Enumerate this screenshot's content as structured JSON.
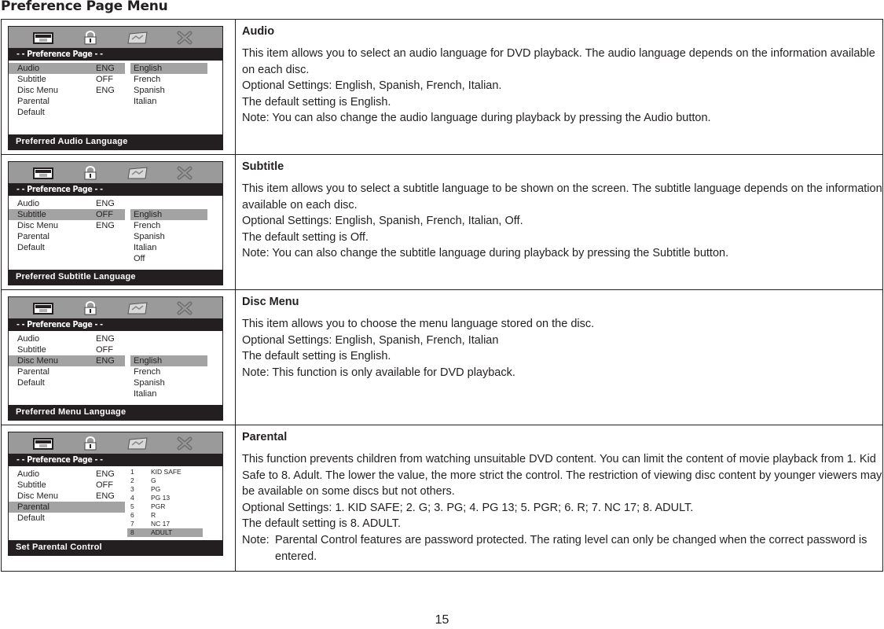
{
  "page_title": "Preference Page Menu",
  "page_number": "15",
  "osd_common": {
    "icons": [
      "general-setup-icon",
      "lock-icon",
      "preference-icon",
      "exit-icon"
    ],
    "header": "- - Preference Page - -",
    "menu_items": [
      {
        "label": "Audio",
        "value": "ENG"
      },
      {
        "label": "Subtitle",
        "value": "OFF"
      },
      {
        "label": "Disc Menu",
        "value": "ENG"
      },
      {
        "label": "Parental",
        "value": ""
      },
      {
        "label": "Default",
        "value": ""
      }
    ]
  },
  "sections": [
    {
      "osd": {
        "selected_menu": 0,
        "options": [
          "English",
          "French",
          "Spanish",
          "Italian"
        ],
        "selected_option": 0,
        "footer": "Preferred  Audio  Language"
      },
      "heading": "Audio",
      "paragraphs": [
        "This item allows you to select an audio language for DVD playback. The audio language depends on the information available on each disc.",
        "Optional Settings: English, Spanish, French, Italian.",
        "The default setting is English.",
        "Note: You can also change the audio language during playback by pressing the Audio button."
      ]
    },
    {
      "osd": {
        "selected_menu": 1,
        "options": [
          "English",
          "French",
          "Spanish",
          "Italian",
          "Off"
        ],
        "selected_option": 0,
        "footer": "Preferred  Subtitle  Language"
      },
      "heading": "Subtitle",
      "paragraphs": [
        "This item allows you to select a subtitle language to be shown on the screen. The subtitle language depends on the information available on each disc.",
        "Optional Settings: English, Spanish, French, Italian, Off.",
        "The default setting is Off.",
        "Note: You can also change the subtitle language during playback by pressing the Subtitle button."
      ]
    },
    {
      "osd": {
        "selected_menu": 2,
        "options": [
          "English",
          "French",
          "Spanish",
          "Italian"
        ],
        "selected_option": 0,
        "footer": "Preferred  Menu  Language"
      },
      "heading": "Disc Menu",
      "paragraphs": [
        "This item allows you to choose the menu language stored on the disc.",
        "Optional Settings: English, Spanish, French, Italian",
        "The default setting is English.",
        "Note: This function is only available for DVD playback."
      ]
    },
    {
      "osd": {
        "selected_menu": 3,
        "ratings": [
          {
            "num": "1",
            "label": "KID SAFE"
          },
          {
            "num": "2",
            "label": "G"
          },
          {
            "num": "3",
            "label": "PG"
          },
          {
            "num": "4",
            "label": "PG  13"
          },
          {
            "num": "5",
            "label": "PGR"
          },
          {
            "num": "6",
            "label": "R"
          },
          {
            "num": "7",
            "label": "NC  17"
          },
          {
            "num": "8",
            "label": "ADULT"
          }
        ],
        "selected_rating": 7,
        "footer": "Set  Parental  Control"
      },
      "heading": "Parental",
      "paragraphs": [
        "This function prevents children from watching unsuitable DVD content. You can limit the content of movie playback from 1. Kid Safe to 8. Adult. The lower the value, the more strict the control. The restriction of viewing disc content by younger viewers may be available on some discs but not others.",
        "Optional Settings: 1.  KID SAFE;   2.  G;   3.  PG;   4.  PG 13;   5.  PGR;   6.  R;   7.  NC 17;   8.  ADULT.",
        "The default setting is 8.  ADULT."
      ],
      "note_label": "Note:",
      "note_text": "Parental Control features are password protected. The rating level can only be changed when the correct password is entered."
    }
  ]
}
